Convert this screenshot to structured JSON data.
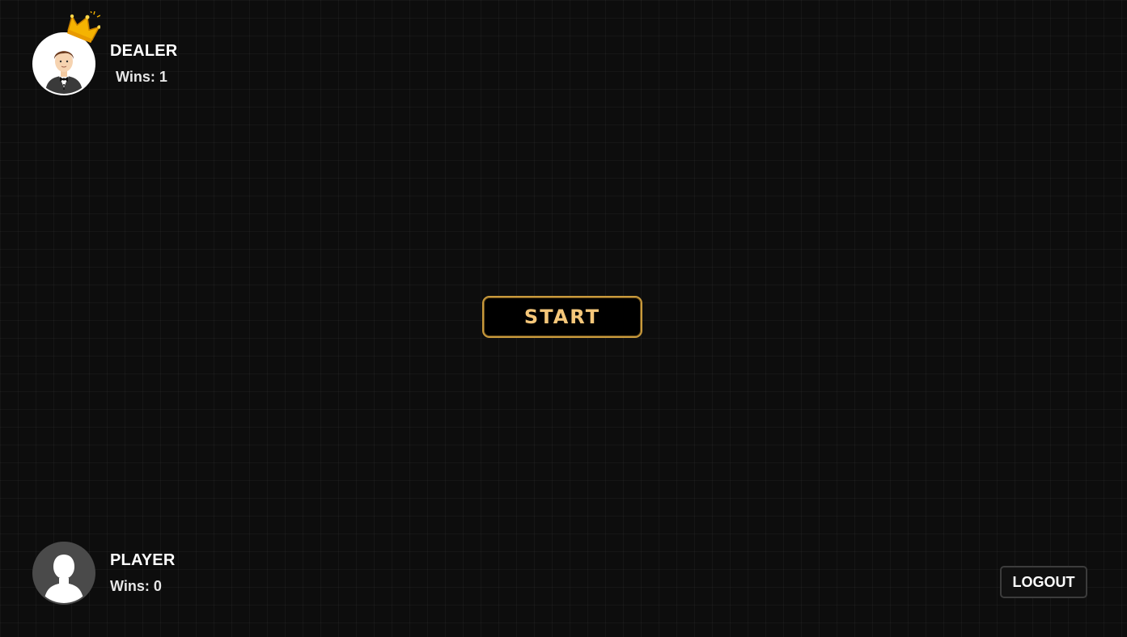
{
  "dealer": {
    "name": "DEALER",
    "wins": "Wins: 1",
    "avatar_icon": "dealer-avatar-icon",
    "leader_icon": "crown-icon"
  },
  "player": {
    "name": "PLAYER",
    "wins": "Wins: 0",
    "avatar_icon": "user-silhouette-icon"
  },
  "actions": {
    "start_label": "START",
    "logout_label": "LOGOUT"
  },
  "colors": {
    "background": "#0d0d0d",
    "start_border": "#c99a3c",
    "start_text": "#f5c77a",
    "crown": "#f5b301"
  }
}
